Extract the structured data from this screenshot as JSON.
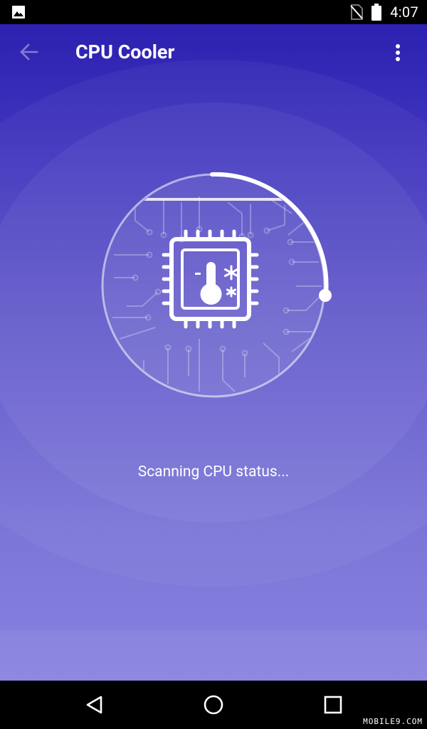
{
  "status_bar": {
    "time": "4:07",
    "icons": [
      "image-icon",
      "no-sim-icon",
      "battery-icon"
    ]
  },
  "toolbar": {
    "title": "CPU Cooler",
    "back_icon": "arrow-back-icon",
    "menu_icon": "more-vert-icon"
  },
  "scan": {
    "icon": "cpu-thermometer-icon",
    "status_text": "Scanning CPU status..."
  },
  "nav_bar": {
    "icons": [
      "back-triangle-icon",
      "home-circle-icon",
      "recents-square-icon"
    ]
  },
  "watermark": "MOBILE9.COM",
  "colors": {
    "background_top": "#2c21b0",
    "background_bottom": "#8781e0",
    "foreground": "#ffffff"
  }
}
